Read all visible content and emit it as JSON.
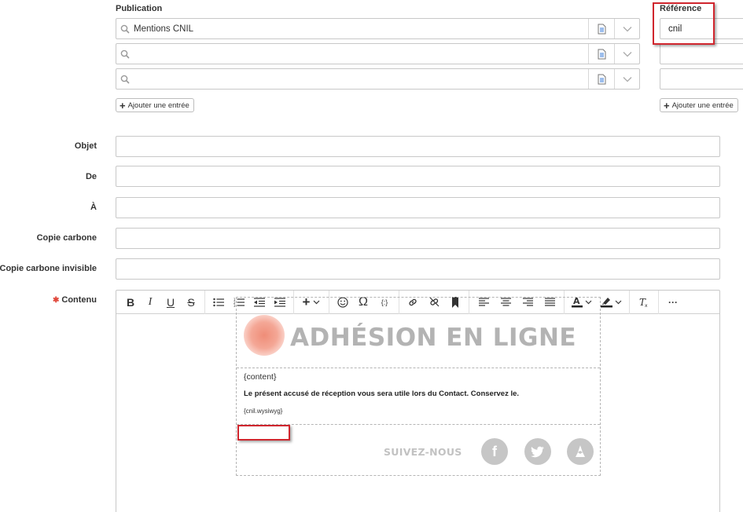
{
  "publication": {
    "label": "Publication",
    "rows": [
      {
        "value": "Mentions CNIL"
      },
      {
        "value": ""
      },
      {
        "value": ""
      }
    ],
    "add_label": "Ajouter une entrée"
  },
  "reference": {
    "label": "Référence",
    "values": [
      "cnil",
      "",
      ""
    ],
    "add_label": "Ajouter une entrée"
  },
  "fields": {
    "objet": "Objet",
    "de": "De",
    "a": "À",
    "cc": "Copie carbone",
    "bcc": "Copie carbone invisible",
    "content": "Contenu"
  },
  "toolbar": {
    "bold": "B",
    "italic": "I",
    "underline": "U",
    "strike": "S",
    "omega": "Ω",
    "vars": "{:}",
    "more": "···"
  },
  "email": {
    "banner_title": "ADHÉSION EN LIGNE",
    "content_placeholder": "{content}",
    "notice": "Le présent accusé de réception vous sera utile lors du Contact. Conservez le.",
    "cnil_placeholder": "{cnil.wysiwyg}",
    "follow_label": "SUIVEZ-NOUS",
    "social": [
      "f",
      "t",
      "l"
    ]
  },
  "colors": {
    "highlight": "#d0262e",
    "required": "#e0473a"
  }
}
